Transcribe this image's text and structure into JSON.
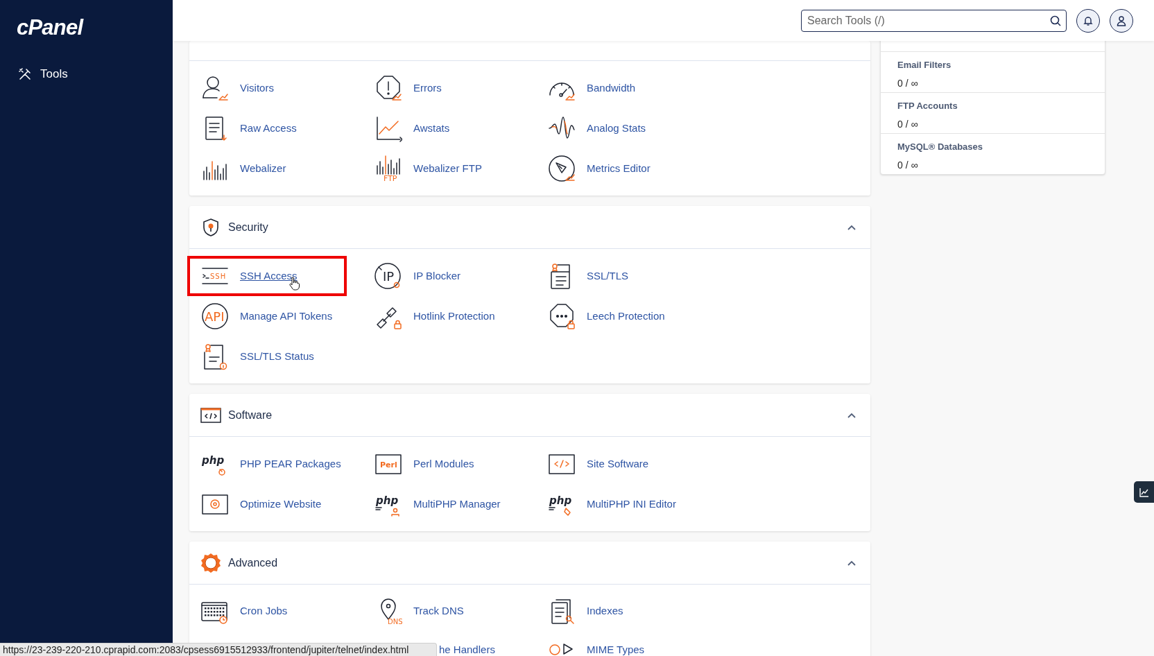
{
  "sidebar": {
    "logo": "cPanel",
    "items": [
      {
        "label": "Tools"
      }
    ]
  },
  "header": {
    "search": {
      "placeholder": "Search Tools (/)"
    }
  },
  "sections": [
    {
      "items": [
        {
          "label": "Visitors",
          "highlighted": false,
          "hovered": false
        },
        {
          "label": "Errors",
          "highlighted": false,
          "hovered": false
        },
        {
          "label": "Bandwidth",
          "highlighted": false,
          "hovered": false
        },
        {
          "label": "Raw Access",
          "highlighted": false,
          "hovered": false
        },
        {
          "label": "Awstats",
          "highlighted": false,
          "hovered": false
        },
        {
          "label": "Analog Stats",
          "highlighted": false,
          "hovered": false
        },
        {
          "label": "Webalizer",
          "highlighted": false,
          "hovered": false
        },
        {
          "label": "Webalizer FTP",
          "icon_text": "FTP",
          "highlighted": false,
          "hovered": false
        },
        {
          "label": "Metrics Editor",
          "highlighted": false,
          "hovered": false
        }
      ]
    },
    {
      "title": "Security",
      "expanded": true,
      "items": [
        {
          "label": "SSH Access",
          "icon_text": "SSH",
          "highlighted": true,
          "hovered": true
        },
        {
          "label": "IP Blocker",
          "icon_text": "IP",
          "highlighted": false,
          "hovered": false
        },
        {
          "label": "SSL/TLS",
          "highlighted": false,
          "hovered": false
        },
        {
          "label": "Manage API Tokens",
          "icon_text": "API",
          "highlighted": false,
          "hovered": false
        },
        {
          "label": "Hotlink Protection",
          "highlighted": false,
          "hovered": false
        },
        {
          "label": "Leech Protection",
          "highlighted": false,
          "hovered": false
        },
        {
          "label": "SSL/TLS Status",
          "highlighted": false,
          "hovered": false
        }
      ]
    },
    {
      "title": "Software",
      "expanded": true,
      "items": [
        {
          "label": "PHP PEAR Packages",
          "icon_text": "php",
          "highlighted": false,
          "hovered": false
        },
        {
          "label": "Perl Modules",
          "icon_text": "Perl",
          "highlighted": false,
          "hovered": false
        },
        {
          "label": "Site Software",
          "highlighted": false,
          "hovered": false
        },
        {
          "label": "Optimize Website",
          "highlighted": false,
          "hovered": false
        },
        {
          "label": "MultiPHP Manager",
          "icon_text": "php",
          "highlighted": false,
          "hovered": false
        },
        {
          "label": "MultiPHP INI Editor",
          "icon_text": "php",
          "highlighted": false,
          "hovered": false
        }
      ]
    },
    {
      "title": "Advanced",
      "expanded": true,
      "items": [
        {
          "label": "Cron Jobs",
          "highlighted": false,
          "hovered": false
        },
        {
          "label": "Track DNS",
          "icon_text": "DNS",
          "highlighted": false,
          "hovered": false
        },
        {
          "label": "Indexes",
          "highlighted": false,
          "hovered": false
        },
        {
          "kind": "partial",
          "label": "he Handlers",
          "highlighted": false,
          "hovered": false
        },
        {
          "label": "MIME Types",
          "highlighted": false,
          "hovered": false
        }
      ]
    }
  ],
  "stats": [
    {
      "label": "Email Filters",
      "value": "0 / ∞"
    },
    {
      "label": "FTP Accounts",
      "value": "0 / ∞"
    },
    {
      "label": "MySQL® Databases",
      "value": "0 / ∞"
    }
  ],
  "status_bar": {
    "url": "https://23-239-220-210.cprapid.com:2083/cpsess6915512933/frontend/jupiter/telnet/index.html"
  }
}
